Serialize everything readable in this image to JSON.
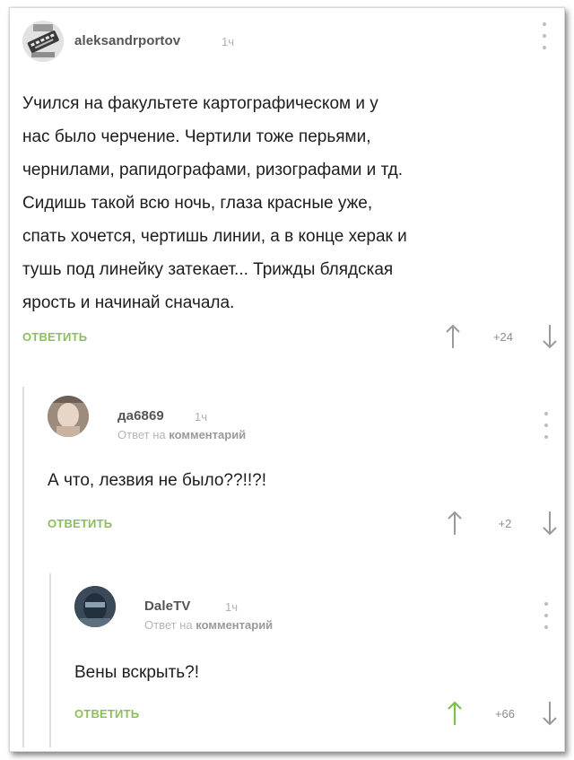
{
  "comments": [
    {
      "username": "aleksandrportov",
      "time": "1ч",
      "text": "Учился на факультете картографическом и у\nнас было черчение. Чертили тоже перьями,\nчернилами, рапидографами, ризографами и тд.\n Сидишь такой всю ночь, глаза красные уже,\nспать хочется, чертишь линии, а в конце херак и\nтушь под линейку затекает... Трижды блядская\nярость и начинай сначала.",
      "reply_label": "ОТВЕТИТЬ",
      "score": "+24",
      "up_color": "#9a9a9a"
    },
    {
      "username": "да6869",
      "time": "1ч",
      "reply_prefix": "Ответ на",
      "reply_target": "комментарий",
      "text": "А что, лезвия не было??!!?!",
      "reply_label": "ОТВЕТИТЬ",
      "score": "+2",
      "up_color": "#9a9a9a"
    },
    {
      "username": "DaleTV",
      "time": "1ч",
      "reply_prefix": "Ответ на",
      "reply_target": "комментарий",
      "text": "Вены вскрыть?!",
      "reply_label": "ОТВЕТИТЬ",
      "score": "+66",
      "up_color": "#7cbf4a"
    }
  ],
  "colors": {
    "accent_green": "#8cbf5a",
    "upvoted_green": "#7cbf4a",
    "muted_gray": "#9a9a9a"
  }
}
